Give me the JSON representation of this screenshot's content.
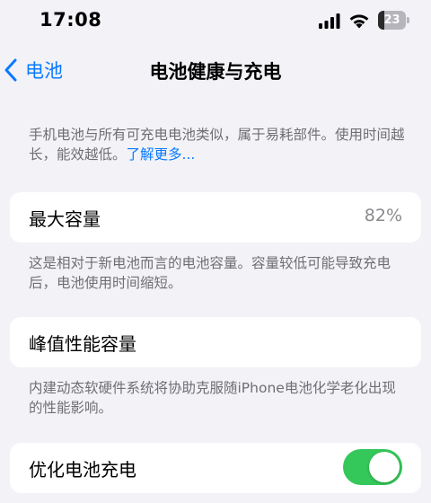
{
  "status_bar": {
    "time": "17:08",
    "battery_level": "23",
    "battery_fraction": 0.23,
    "icons": [
      "signal-icon",
      "wifi-icon",
      "battery-icon"
    ]
  },
  "nav": {
    "back_label": "电池",
    "back_icon": "chevron-left-icon",
    "title": "电池健康与充电"
  },
  "intro": {
    "text": "手机电池与所有可充电电池类似，属于易耗部件。使用时间越长，能效越低。",
    "link": "了解更多..."
  },
  "max_capacity": {
    "label": "最大容量",
    "value": "82%",
    "note": "这是相对于新电池而言的电池容量。容量较低可能导致充电后，电池使用时间缩短。"
  },
  "peak_performance": {
    "label": "峰值性能容量",
    "note": "内建动态软硬件系统将协助克服随iPhone电池化学老化出现的性能影响。"
  },
  "optimized_charging": {
    "label": "优化电池充电",
    "enabled": true
  },
  "colors": {
    "accent": "#0a7aff",
    "toggle_on": "#34c759",
    "background": "#f2f2f7",
    "secondary_text": "#6e6e73"
  }
}
